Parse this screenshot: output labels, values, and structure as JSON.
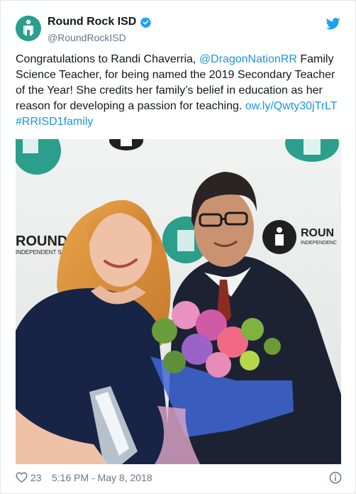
{
  "tweet": {
    "display_name": "Round Rock ISD",
    "handle": "@RoundRockISD",
    "text_1": "Congratulations to Randi Chaverria, ",
    "mention": "@DragonNationRR",
    "text_2": " Family Science Teacher, for being named the 2019 Secondary Teacher of the Year! She credits her family’s belief in education as her reason for developing a passion for teaching. ",
    "url": "ow.ly/Qwty30jTrLT",
    "hashtag": "#RRISD1family",
    "likes": "23",
    "timestamp": "5:16 PM - May 8, 2018"
  },
  "media": {
    "backdrop_text_1": "ROUND",
    "backdrop_sub_1": "INDEPENDENT SC",
    "backdrop_text_2": "ROUN",
    "backdrop_sub_2": "INDEPENDENC"
  },
  "colors": {
    "brand_teal": "#2b9e8c",
    "twitter_blue": "#1da1f2",
    "link_blue": "#1b95e0",
    "text": "#14171a",
    "muted": "#657786"
  },
  "icons": {
    "avatar": "round-rock-isd-logo",
    "verified": "verified-badge",
    "brand": "twitter-bird",
    "like": "heart",
    "info": "info-circle"
  }
}
